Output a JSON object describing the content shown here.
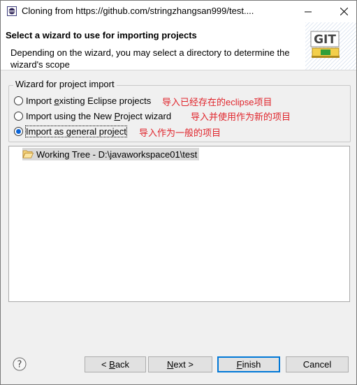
{
  "window": {
    "title": "Cloning from https://github.com/stringzhangsan999/test...."
  },
  "banner": {
    "title": "Select a wizard to use for importing projects",
    "description": "Depending on the wizard, you may select a directory to determine the wizard's scope",
    "logo_text": "GIT"
  },
  "group": {
    "legend": "Wizard for project import",
    "options": [
      {
        "pre": "Import ",
        "mnemonic": "e",
        "post": "xisting Eclipse projects",
        "note": "导入已经存在的eclipse项目",
        "selected": false
      },
      {
        "pre": "Import using the New ",
        "mnemonic": "P",
        "post": "roject wizard",
        "note": "导入并使用作为新的项目",
        "selected": false
      },
      {
        "pre": "Import as ",
        "mnemonic": "g",
        "post": "eneral project",
        "note": "导入作为一般的项目",
        "selected": true
      }
    ]
  },
  "tree": {
    "items": [
      {
        "label": "Working Tree - D:\\javaworkspace01\\test"
      }
    ]
  },
  "buttons": {
    "back": {
      "pre": "< ",
      "mnemonic": "B",
      "post": "ack"
    },
    "next": {
      "pre": "",
      "mnemonic": "N",
      "post": "ext >"
    },
    "finish": {
      "pre": "",
      "mnemonic": "F",
      "post": "inish"
    },
    "cancel": {
      "pre": "Cancel",
      "mnemonic": "",
      "post": ""
    }
  },
  "colors": {
    "annotation": "#e0242b",
    "radio_selected": "#0a64d8",
    "default_button_border": "#0078d7"
  }
}
